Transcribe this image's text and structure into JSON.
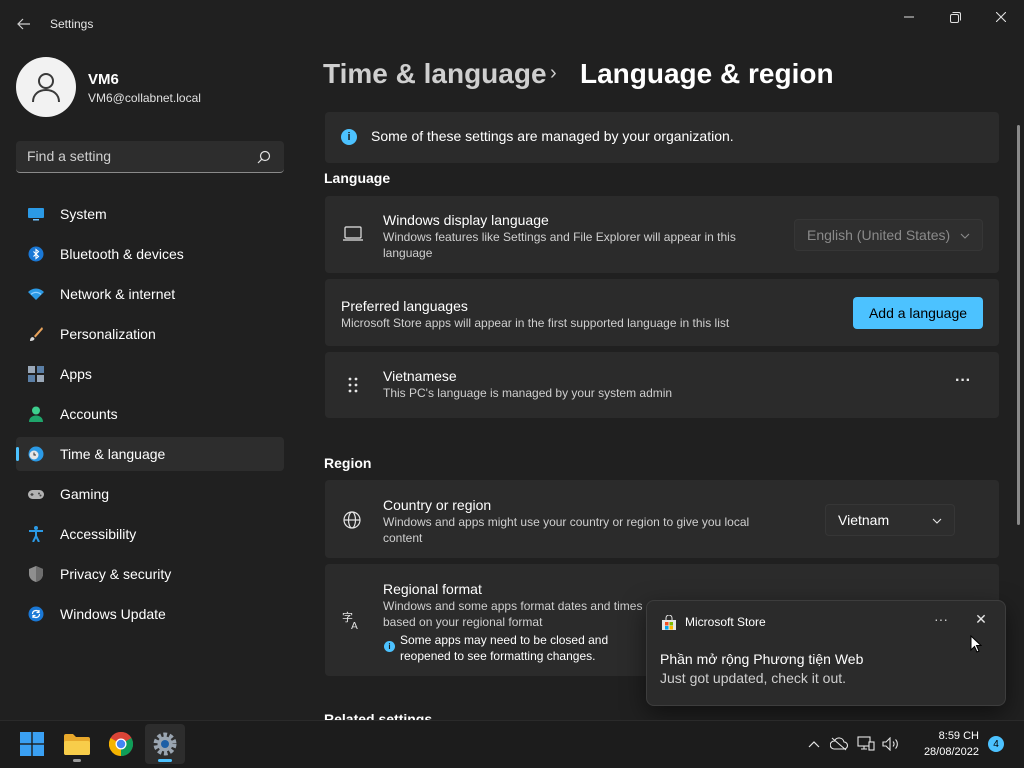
{
  "window": {
    "title": "Settings",
    "back_icon": "back-arrow-icon"
  },
  "user": {
    "name": "VM6",
    "email": "VM6@collabnet.local"
  },
  "search": {
    "placeholder": "Find a setting",
    "icon": "search-icon"
  },
  "nav": [
    {
      "label": "System",
      "icon": "monitor-icon",
      "active": false
    },
    {
      "label": "Bluetooth & devices",
      "icon": "bluetooth-icon",
      "active": false
    },
    {
      "label": "Network & internet",
      "icon": "wifi-icon",
      "active": false
    },
    {
      "label": "Personalization",
      "icon": "brush-icon",
      "active": false
    },
    {
      "label": "Apps",
      "icon": "apps-icon",
      "active": false
    },
    {
      "label": "Accounts",
      "icon": "person-icon",
      "active": false
    },
    {
      "label": "Time & language",
      "icon": "clock-globe-icon",
      "active": true
    },
    {
      "label": "Gaming",
      "icon": "gamepad-icon",
      "active": false
    },
    {
      "label": "Accessibility",
      "icon": "accessibility-icon",
      "active": false
    },
    {
      "label": "Privacy & security",
      "icon": "shield-icon",
      "active": false
    },
    {
      "label": "Windows Update",
      "icon": "update-icon",
      "active": false
    }
  ],
  "breadcrumb": {
    "parent": "Time & language",
    "separator": "›",
    "current": "Language & region"
  },
  "info_banner": {
    "text": "Some of these settings are managed by your organization.",
    "icon": "info-icon"
  },
  "language": {
    "section_title": "Language",
    "display_language": {
      "title": "Windows display language",
      "subtitle": "Windows features like Settings and File Explorer will appear in this language",
      "value": "English (United States)",
      "icon": "laptop-icon"
    },
    "preferred": {
      "title": "Preferred languages",
      "subtitle": "Microsoft Store apps will appear in the first supported language in this list",
      "button": "Add a language"
    },
    "installed": [
      {
        "title": "Vietnamese",
        "subtitle": "This PC's language is managed by your system admin",
        "icon": "drag-handle-icon",
        "more": "···"
      }
    ]
  },
  "region": {
    "section_title": "Region",
    "country": {
      "title": "Country or region",
      "subtitle": "Windows and apps might use your country or region to give you local content",
      "value": "Vietnam",
      "icon": "globe-icon"
    },
    "format": {
      "title": "Regional format",
      "subtitle": "Windows and some apps format dates and times based on your regional format",
      "note": "Some apps may need to be closed and reopened to see formatting changes.",
      "icon": "language-format-icon"
    }
  },
  "related_settings": {
    "title": "Related settings"
  },
  "toast": {
    "app": "Microsoft Store",
    "title": "Phần mở rộng Phương tiện Web",
    "body": "Just got updated, check it out.",
    "more": "···",
    "close": "✕"
  },
  "taskbar": {
    "apps": [
      "start-icon",
      "file-explorer-icon",
      "chrome-icon",
      "settings-icon"
    ],
    "time": "8:59 CH",
    "date": "28/08/2022",
    "notification_count": "4"
  },
  "colors": {
    "accent": "#4cc2ff",
    "background": "#202020",
    "card": "#2b2b2b"
  }
}
